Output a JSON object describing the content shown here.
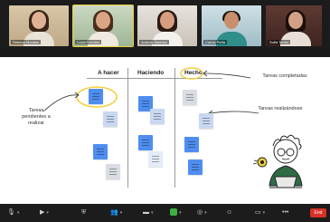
{
  "participants": [
    {
      "name": "Rebeca Morales"
    },
    {
      "name": "Lucia Fuentes"
    },
    {
      "name": "Andrea Jimenez"
    },
    {
      "name": "Carlos Peña"
    },
    {
      "name": "Sofia Torres"
    }
  ],
  "board": {
    "columns": [
      "A hacer",
      "Haciendo",
      "Hecho"
    ],
    "annotations": {
      "pending": "Tareas pendientes a realizar",
      "completed": "Tareas completadas",
      "in_progress": "Tareas realizándose"
    }
  },
  "toolbar": {
    "end_label": "End"
  },
  "colors": {
    "highlight": "#f2d13b",
    "note_blue": "#4f8ef0",
    "end_button": "#d93025"
  }
}
